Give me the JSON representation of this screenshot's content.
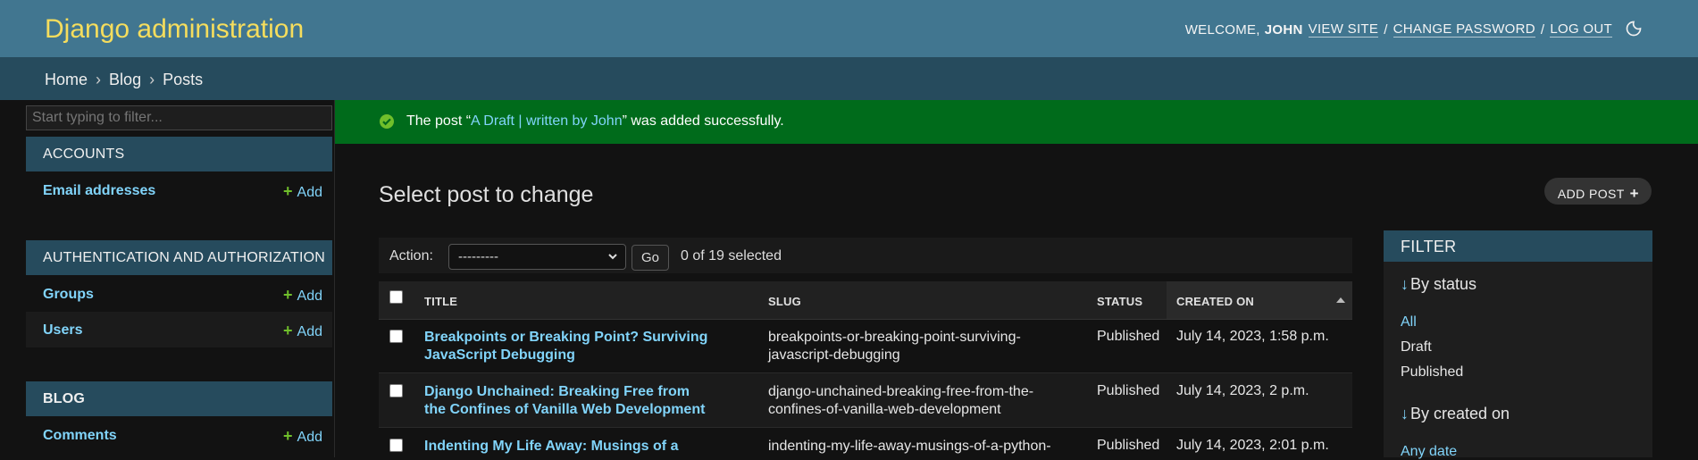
{
  "header": {
    "branding": "Django administration",
    "welcome": "WELCOME,",
    "username": "JOHN",
    "view_site": "VIEW SITE",
    "change_password": "CHANGE PASSWORD",
    "log_out": "LOG OUT",
    "separator": "/",
    "theme_icon": "moon-icon"
  },
  "breadcrumbs": {
    "home": "Home",
    "blog": "Blog",
    "current": "Posts",
    "separator": "›"
  },
  "sidebar": {
    "filter_placeholder": "Start typing to filter...",
    "add_label": "Add",
    "apps": [
      {
        "caption": "ACCOUNTS",
        "models": [
          "Email addresses"
        ]
      },
      {
        "caption": "AUTHENTICATION AND AUTHORIZATION",
        "models": [
          "Groups",
          "Users"
        ]
      },
      {
        "caption": "BLOG",
        "models": [
          "Comments"
        ]
      }
    ]
  },
  "message": {
    "prefix": "The post “",
    "link": "A Draft | written by John",
    "suffix": "” was added successfully.",
    "icon": "check-circle-icon"
  },
  "main": {
    "title": "Select post to change",
    "add_button": "ADD POST"
  },
  "actions": {
    "label": "Action:",
    "select_value": "---------",
    "go": "Go",
    "selected": "0 of 19 selected"
  },
  "table": {
    "headers": [
      "TITLE",
      "SLUG",
      "STATUS",
      "CREATED ON"
    ],
    "rows": [
      {
        "title": "Breakpoints or Breaking Point? Surviving JavaScript Debugging",
        "slug": "breakpoints-or-breaking-point-surviving-javascript-debugging",
        "status": "Published",
        "created": "July 14, 2023, 1:58 p.m."
      },
      {
        "title": "Django Unchained: Breaking Free from the Confines of Vanilla Web Development",
        "slug": "django-unchained-breaking-free-from-the-confines-of-vanilla-web-development",
        "status": "Published",
        "created": "July 14, 2023, 2 p.m."
      },
      {
        "title": "Indenting My Life Away: Musings of a Python",
        "slug": "indenting-my-life-away-musings-of-a-python-",
        "status": "Published",
        "created": "July 14, 2023, 2:01 p.m."
      }
    ]
  },
  "filter": {
    "heading": "FILTER",
    "groups": [
      {
        "title": "By status",
        "options": [
          "All",
          "Draft",
          "Published"
        ],
        "selected": "All"
      },
      {
        "title": "By created on",
        "options": [
          "Any date"
        ],
        "selected": "Any date"
      }
    ]
  },
  "colors": {
    "header_bg": "#417690",
    "branding": "#f5dd5d",
    "breadcrumbs_bg": "#264b5d",
    "success_bg": "#006b1b",
    "link": "#81d4fa",
    "add_plus": "#70bf2b"
  }
}
